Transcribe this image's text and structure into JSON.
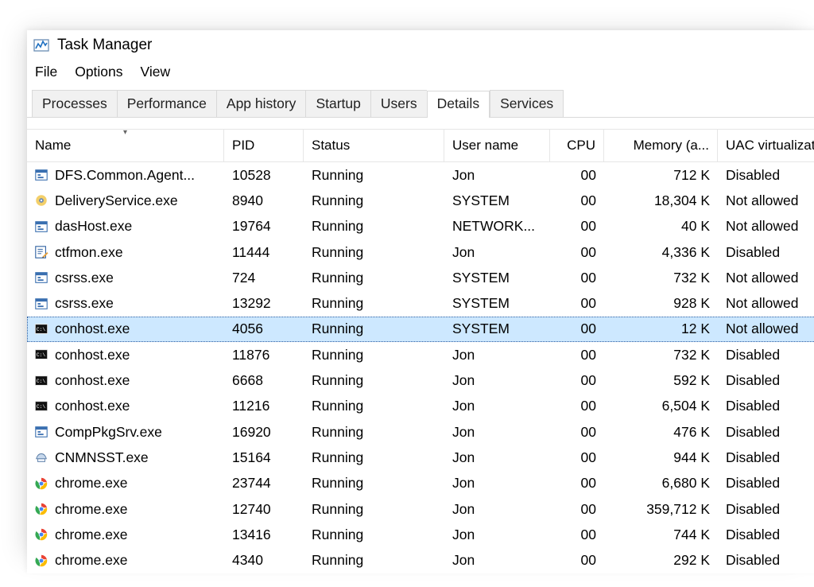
{
  "window": {
    "title": "Task Manager"
  },
  "menu": {
    "file": "File",
    "options": "Options",
    "view": "View"
  },
  "tabs": [
    {
      "label": "Processes",
      "active": false
    },
    {
      "label": "Performance",
      "active": false
    },
    {
      "label": "App history",
      "active": false
    },
    {
      "label": "Startup",
      "active": false
    },
    {
      "label": "Users",
      "active": false
    },
    {
      "label": "Details",
      "active": true
    },
    {
      "label": "Services",
      "active": false
    }
  ],
  "columns": {
    "name": "Name",
    "pid": "PID",
    "status": "Status",
    "user": "User name",
    "cpu": "CPU",
    "memory": "Memory (a...",
    "uac": "UAC virtualizat..."
  },
  "sort": {
    "column": "name",
    "direction": "desc"
  },
  "rows": [
    {
      "icon": "app",
      "name": "DFS.Common.Agent...",
      "pid": "10528",
      "status": "Running",
      "user": "Jon",
      "cpu": "00",
      "memory": "712 K",
      "uac": "Disabled",
      "selected": false
    },
    {
      "icon": "gear",
      "name": "DeliveryService.exe",
      "pid": "8940",
      "status": "Running",
      "user": "SYSTEM",
      "cpu": "00",
      "memory": "18,304 K",
      "uac": "Not allowed",
      "selected": false
    },
    {
      "icon": "app",
      "name": "dasHost.exe",
      "pid": "19764",
      "status": "Running",
      "user": "NETWORK...",
      "cpu": "00",
      "memory": "40 K",
      "uac": "Not allowed",
      "selected": false
    },
    {
      "icon": "edit",
      "name": "ctfmon.exe",
      "pid": "11444",
      "status": "Running",
      "user": "Jon",
      "cpu": "00",
      "memory": "4,336 K",
      "uac": "Disabled",
      "selected": false
    },
    {
      "icon": "app",
      "name": "csrss.exe",
      "pid": "724",
      "status": "Running",
      "user": "SYSTEM",
      "cpu": "00",
      "memory": "732 K",
      "uac": "Not allowed",
      "selected": false
    },
    {
      "icon": "app",
      "name": "csrss.exe",
      "pid": "13292",
      "status": "Running",
      "user": "SYSTEM",
      "cpu": "00",
      "memory": "928 K",
      "uac": "Not allowed",
      "selected": false
    },
    {
      "icon": "console",
      "name": "conhost.exe",
      "pid": "4056",
      "status": "Running",
      "user": "SYSTEM",
      "cpu": "00",
      "memory": "12 K",
      "uac": "Not allowed",
      "selected": true
    },
    {
      "icon": "console",
      "name": "conhost.exe",
      "pid": "11876",
      "status": "Running",
      "user": "Jon",
      "cpu": "00",
      "memory": "732 K",
      "uac": "Disabled",
      "selected": false
    },
    {
      "icon": "console",
      "name": "conhost.exe",
      "pid": "6668",
      "status": "Running",
      "user": "Jon",
      "cpu": "00",
      "memory": "592 K",
      "uac": "Disabled",
      "selected": false
    },
    {
      "icon": "console",
      "name": "conhost.exe",
      "pid": "11216",
      "status": "Running",
      "user": "Jon",
      "cpu": "00",
      "memory": "6,504 K",
      "uac": "Disabled",
      "selected": false
    },
    {
      "icon": "app",
      "name": "CompPkgSrv.exe",
      "pid": "16920",
      "status": "Running",
      "user": "Jon",
      "cpu": "00",
      "memory": "476 K",
      "uac": "Disabled",
      "selected": false
    },
    {
      "icon": "printer",
      "name": "CNMNSST.exe",
      "pid": "15164",
      "status": "Running",
      "user": "Jon",
      "cpu": "00",
      "memory": "944 K",
      "uac": "Disabled",
      "selected": false
    },
    {
      "icon": "chrome",
      "name": "chrome.exe",
      "pid": "23744",
      "status": "Running",
      "user": "Jon",
      "cpu": "00",
      "memory": "6,680 K",
      "uac": "Disabled",
      "selected": false
    },
    {
      "icon": "chrome",
      "name": "chrome.exe",
      "pid": "12740",
      "status": "Running",
      "user": "Jon",
      "cpu": "00",
      "memory": "359,712 K",
      "uac": "Disabled",
      "selected": false
    },
    {
      "icon": "chrome",
      "name": "chrome.exe",
      "pid": "13416",
      "status": "Running",
      "user": "Jon",
      "cpu": "00",
      "memory": "744 K",
      "uac": "Disabled",
      "selected": false
    },
    {
      "icon": "chrome",
      "name": "chrome.exe",
      "pid": "4340",
      "status": "Running",
      "user": "Jon",
      "cpu": "00",
      "memory": "292 K",
      "uac": "Disabled",
      "selected": false
    }
  ]
}
